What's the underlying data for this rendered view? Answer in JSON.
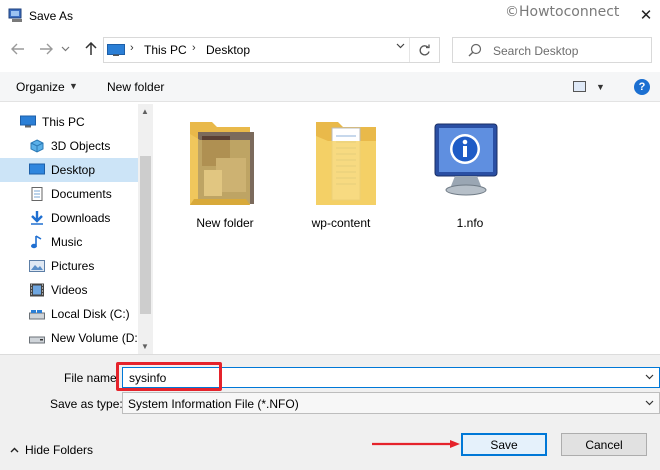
{
  "window": {
    "title": "Save As",
    "watermark": "©Howtoconnect",
    "close_glyph": "✕"
  },
  "nav": {
    "back_icon": "arrow-left-icon",
    "forward_icon": "arrow-right-icon",
    "recent_icon": "chevron-down-icon",
    "up_icon": "arrow-up-icon",
    "breadcrumbs": [
      "This PC",
      "Desktop"
    ],
    "refresh_icon": "refresh-icon",
    "search_placeholder": "Search Desktop"
  },
  "toolbar": {
    "organize_label": "Organize",
    "new_folder_label": "New folder",
    "view_icon": "view-options-icon",
    "help_label": "?"
  },
  "sidebar": {
    "items": [
      {
        "label": "This PC",
        "icon": "this-pc-icon",
        "selected": false
      },
      {
        "label": "3D Objects",
        "icon": "3d-objects-icon",
        "selected": false
      },
      {
        "label": "Desktop",
        "icon": "desktop-icon",
        "selected": true
      },
      {
        "label": "Documents",
        "icon": "documents-icon",
        "selected": false
      },
      {
        "label": "Downloads",
        "icon": "downloads-icon",
        "selected": false
      },
      {
        "label": "Music",
        "icon": "music-icon",
        "selected": false
      },
      {
        "label": "Pictures",
        "icon": "pictures-icon",
        "selected": false
      },
      {
        "label": "Videos",
        "icon": "videos-icon",
        "selected": false
      },
      {
        "label": "Local Disk (C:)",
        "icon": "local-disk-icon",
        "selected": false
      },
      {
        "label": "New Volume (D:",
        "icon": "drive-icon",
        "selected": false
      }
    ]
  },
  "files": [
    {
      "name": "New folder",
      "icon": "folder-with-photo-icon"
    },
    {
      "name": "wp-content",
      "icon": "folder-with-documents-icon"
    },
    {
      "name": "1.nfo",
      "icon": "system-info-file-icon"
    }
  ],
  "form": {
    "file_name_label": "File name:",
    "file_name_value": "sysinfo",
    "save_as_type_label": "Save as type:",
    "save_as_type_value": "System Information File (*.NFO)"
  },
  "footer": {
    "hide_folders_label": "Hide Folders",
    "save_label": "Save",
    "cancel_label": "Cancel"
  },
  "colors": {
    "accent": "#0078d7",
    "selection": "#cce4f7",
    "annotation_red": "#e5232b",
    "folder_yellow": "#f6d36b"
  }
}
